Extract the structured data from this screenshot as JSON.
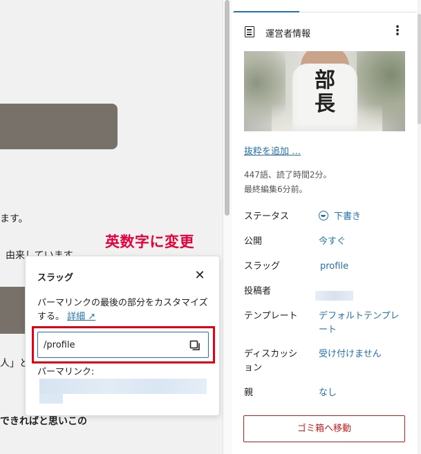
{
  "annotation": {
    "text": "英数字に変更",
    "color": "#e8003a"
  },
  "canvas": {
    "lines": [
      "ます。",
      "由来しています",
      "人」と",
      "できればと思いこの"
    ]
  },
  "slug_popover": {
    "title": "スラッグ",
    "close_icon": "close-icon",
    "description": "パーマリンクの最後の部分をカスタマイズする。",
    "details_link": "詳細 ↗",
    "slug_value": "/profile",
    "copy_icon": "copy-icon",
    "permalink_label": "パーマリンク:"
  },
  "sidebar": {
    "panel_title": "運営者情報",
    "featured_image_text": "部長",
    "excerpt_link": "抜粋を追加 …",
    "word_count": "447語、読了時間2分。",
    "last_edited": "最終編集6分前。",
    "rows": [
      {
        "label": "ステータス",
        "value": "下書き"
      },
      {
        "label": "公開",
        "value": "今すぐ"
      },
      {
        "label": "スラッグ",
        "value": "profile"
      },
      {
        "label": "投稿者",
        "value": ""
      },
      {
        "label": "テンプレート",
        "value": "デフォルトテンプレート"
      },
      {
        "label": "ディスカッション",
        "value": "受け付けません"
      },
      {
        "label": "親",
        "value": "なし"
      }
    ],
    "trash_button": "ゴミ箱へ移動"
  },
  "colors": {
    "accent": "#2271b1",
    "danger": "#cc1818",
    "highlight": "#e60012"
  }
}
